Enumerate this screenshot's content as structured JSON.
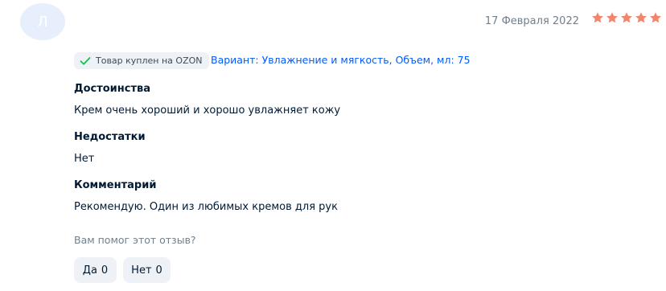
{
  "author": {
    "initial": "Л"
  },
  "review": {
    "date": "17 Февраля 2022",
    "rating": 5,
    "rating_max": 5,
    "star_color": "#f1866c",
    "verified_label": "Товар куплен на OZON",
    "variant": "Вариант: Увлажнение и мягкость, Объем, мл: 75",
    "sections": [
      {
        "title": "Достоинства",
        "text": "Крем очень хороший и хорошо увлажняет кожу"
      },
      {
        "title": "Недостатки",
        "text": "Нет"
      },
      {
        "title": "Комментарий",
        "text": "Рекомендую. Один из любимых кремов для рук"
      }
    ]
  },
  "helpful": {
    "question": "Вам помог этот отзыв?",
    "yes_label": "Да",
    "yes_count": "0",
    "no_label": "Нет",
    "no_count": "0"
  },
  "icons": {
    "star": "star-icon",
    "check": "check-icon"
  },
  "colors": {
    "link": "#005bff",
    "muted_text": "#707f8d",
    "chip_bg": "#eef2f6",
    "verified_check": "#10c44c",
    "avatar_bg": "#e7eefc"
  }
}
